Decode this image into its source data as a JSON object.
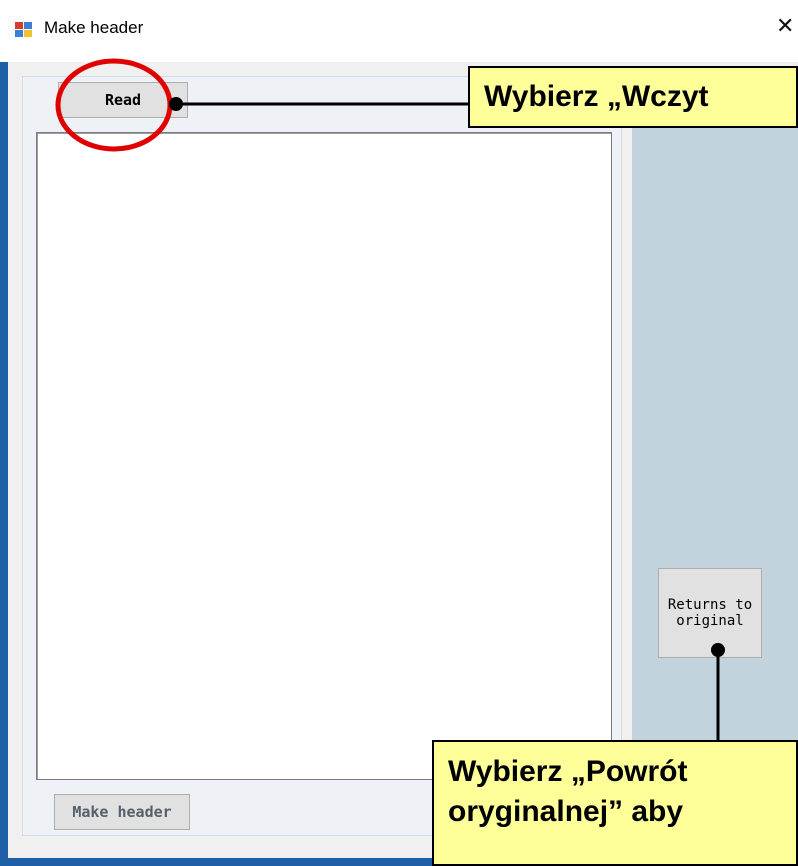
{
  "window": {
    "title": "Make header",
    "close_symbol": "✕",
    "icon": "window-app-icon"
  },
  "buttons": {
    "read_label": "Read",
    "returns_label": "Returns to\noriginal",
    "make_header_label": "Make header"
  },
  "annotations": {
    "top_callout": "Wybierz „Wczyt",
    "bottom_callout_line1": "Wybierz „Powrót",
    "bottom_callout_line2": "oryginalnej” aby",
    "highlight_color": "#e00000",
    "callout_color": "#ffff99"
  },
  "colors": {
    "window_border": "#1f5fa8",
    "right_panel": "#c3d3de",
    "button_face": "#e1e1e1"
  }
}
